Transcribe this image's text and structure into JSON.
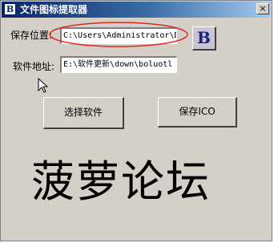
{
  "window": {
    "title": "文件图标提取器",
    "app_icon_letter": "B",
    "close_label": "×"
  },
  "form": {
    "save_location_label": "保存位置:",
    "save_location_value": "C:\\Users\\Administrator\\De",
    "software_address_label": "软件地址:",
    "software_address_value": "E:\\软件更新\\down\\boluotl"
  },
  "buttons": {
    "select_software": "选择软件",
    "save_ico": "保存ICO",
    "bold_b": "B"
  },
  "banner": {
    "text": "菠萝论坛"
  },
  "colors": {
    "window_bg": "#d4d0c8",
    "titlebar_start": "#0a246a",
    "titlebar_end": "#a6caf0",
    "highlight_ellipse": "#e0281e"
  }
}
